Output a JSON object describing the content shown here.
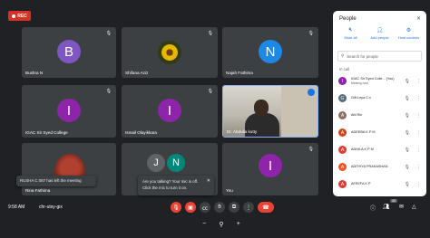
{
  "recording": {
    "label": "REC"
  },
  "tiles": [
    {
      "name": "Bushra N",
      "initial": "B",
      "color": "#7e57c2"
    },
    {
      "name": "Shifana Aziz"
    },
    {
      "name": "Najah Fathima",
      "initial": "N",
      "color": "#1e88e5"
    },
    {
      "name": "IGAC Sir Syed College",
      "initial": "I",
      "color": "#8e24aa"
    },
    {
      "name": "Ismail Olayikkara",
      "initial": "I",
      "color": "#8e24aa"
    },
    {
      "name": "Dr. Abdulla kutty"
    },
    {
      "name": "Rina Fathima"
    },
    {
      "initials": [
        "J",
        "N"
      ],
      "colors": [
        "#5f6368",
        "#00897b"
      ]
    },
    {
      "name": "You",
      "initial": "I",
      "color": "#8e24aa"
    }
  ],
  "toasts": {
    "left": "RUSHA C 087 has left the meeting",
    "mic_line1": "Are you talking? Your mic is off.",
    "mic_line2": "Click the mic to turn it on."
  },
  "people_panel": {
    "title": "People",
    "actions": [
      "Mute all",
      "Add people",
      "Host controls"
    ],
    "search_placeholder": "Search for people",
    "section": "In call",
    "participants": [
      {
        "initial": "I",
        "color": "#8e24aa",
        "name": "IGAC Sir Syed Colle... (You)",
        "sub": "Meeting host"
      },
      {
        "initial": "G",
        "color": "#546e7a",
        "name": "Gift Leya C.v"
      },
      {
        "initial": "A",
        "color": "#8d6e63",
        "name": "Abi Rin"
      },
      {
        "initial": "A",
        "color": "#d84315",
        "name": "ADEEBA K P M"
      },
      {
        "initial": "A",
        "color": "#e53935",
        "name": "ADHILA K P M"
      },
      {
        "initial": "A",
        "color": "#f4511e",
        "name": "ADITHYA PRAKASHAN"
      },
      {
        "initial": "A",
        "color": "#e53935",
        "name": "AFEEFA K P"
      }
    ]
  },
  "bottom_bar": {
    "time": "9:58 AM",
    "meeting_code": "chr-utsy-gix",
    "participant_count": "40"
  }
}
